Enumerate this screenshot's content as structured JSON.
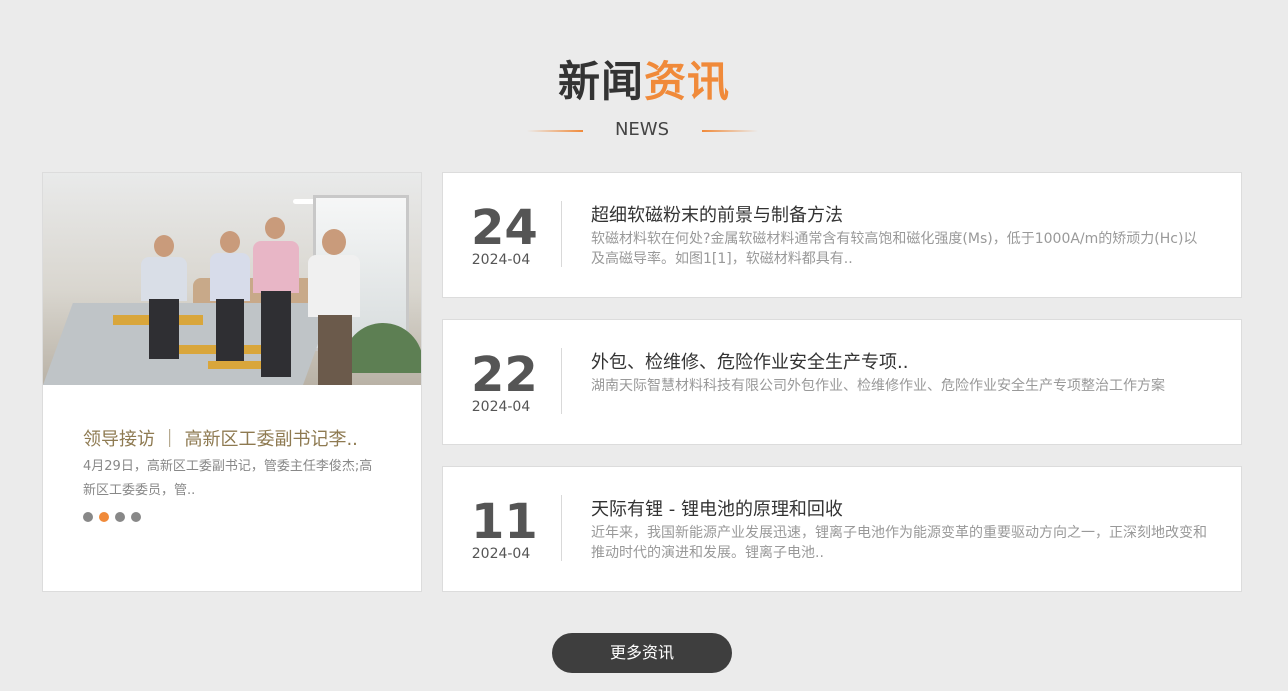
{
  "header": {
    "title_dark": "新闻",
    "title_accent": "资讯",
    "subtitle": "NEWS"
  },
  "feature": {
    "title": "领导接访 ｜ 高新区工委副书记李..",
    "description": "4月29日，高新区工委副书记，管委主任李俊杰;高新区工委委员，管..",
    "dots": 4,
    "active_dot": 1
  },
  "news": [
    {
      "day": "24",
      "month": "2024-04",
      "title": "超细软磁粉末的前景与制备方法",
      "summary": "软磁材料软在何处?金属软磁材料通常含有较高饱和磁化强度(Ms)，低于1000A/m的矫顽力(Hc)以及高磁导率。如图1[1]，软磁材料都具有.."
    },
    {
      "day": "22",
      "month": "2024-04",
      "title": "外包、检维修、危险作业安全生产专项..",
      "summary": "湖南天际智慧材料科技有限公司外包作业、检维修作业、危险作业安全生产专项整治工作方案"
    },
    {
      "day": "11",
      "month": "2024-04",
      "title": "天际有锂 - 锂电池的原理和回收",
      "summary": "近年来，我国新能源产业发展迅速，锂离子电池作为能源变革的重要驱动方向之一，正深刻地改变和推动时代的演进和发展。锂离子电池.."
    }
  ],
  "more_button": "更多资讯",
  "colors": {
    "accent": "#f08a3a",
    "button": "#3e3e3e",
    "background": "#ebebeb"
  }
}
